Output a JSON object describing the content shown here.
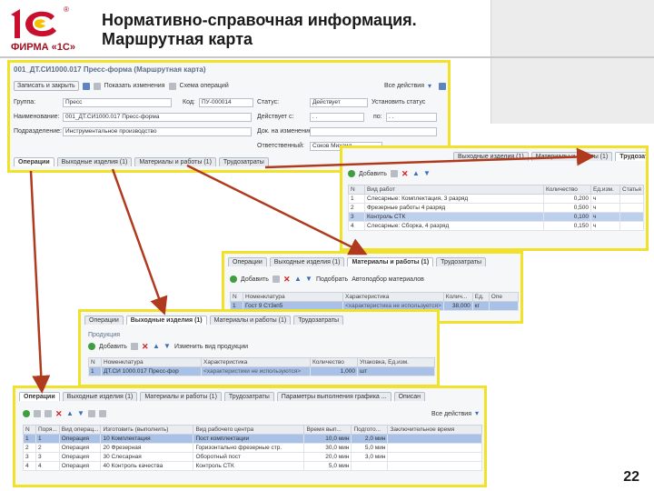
{
  "slide": {
    "title_line1": "Нормативно-справочная информация.",
    "title_line2": "Маршрутная карта",
    "page_number": "22",
    "logo_text": "ФИРМА «1С»",
    "logo_reg": "®"
  },
  "colors": {
    "highlight": "#f2e12a",
    "arrow": "#b03a1e",
    "selection": "#a9c1e6",
    "brand": "#a01020"
  },
  "main_form": {
    "title": "001_ДТ.СИ1000.017 Пресс-форма (Маршрутная карта)",
    "toolbar": {
      "save_close": "Записать и закрыть",
      "show_changes": "Показать изменения",
      "scheme": "Схема операций",
      "all_actions": "Все действия"
    },
    "fields": {
      "group_label": "Группа:",
      "group_value": "Пресс",
      "code_label": "Код:",
      "code_value": "ПУ-000014",
      "status_label": "Статус:",
      "status_value": "Действует",
      "set_status": "Установить статус",
      "name_label": "Наименование:",
      "name_value": "001_ДТ.СИ1000.017 Пресс-форма",
      "valid_from_label": "Действует с:",
      "valid_from_value": ".  .",
      "valid_to_label": "по:",
      "valid_to_value": ".  .",
      "division_label": "Подразделение:",
      "division_value": "Инструментальное производство",
      "document_label": "Док. на изменение:",
      "document_value": "",
      "responsible_label": "Ответственный:",
      "responsible_value": "Соков Михаил"
    },
    "tabs": [
      "Операции",
      "Выходные изделия (1)",
      "Материалы и работы (1)",
      "Трудозатраты"
    ]
  },
  "labor_panel": {
    "tabs": [
      "Выходные изделия (1)",
      "Материалы и работы (1)",
      "Трудозатраты (4)"
    ],
    "add_button": "Добавить",
    "columns": [
      "N",
      "Вид работ",
      "Количество",
      "Ед.изм.",
      "Статья"
    ],
    "rows": [
      {
        "n": "1",
        "work": "Слесарные: Комплектация, 3 разряд",
        "qty": "0,200",
        "unit": "ч",
        "selected": false
      },
      {
        "n": "2",
        "work": "Фрезерные работы  4 разряд",
        "qty": "0,500",
        "unit": "ч",
        "selected": false
      },
      {
        "n": "3",
        "work": "Контроль СТК",
        "qty": "0,100",
        "unit": "ч",
        "selected": true
      },
      {
        "n": "4",
        "work": "Слесарные: Сборка, 4 разряд",
        "qty": "0,150",
        "unit": "ч",
        "selected": false
      }
    ]
  },
  "materials_panel": {
    "tabs": [
      "Операции",
      "Выходные изделия (1)",
      "Материалы и работы (1)",
      "Трудозатраты"
    ],
    "add_button": "Добавить",
    "pick_button": "Подобрать",
    "autopick_button": "Автоподбор материалов",
    "columns": [
      "N",
      "Номенклатура",
      "Характеристика",
      "Колич...",
      "Ед.",
      "Опе"
    ],
    "rows": [
      {
        "n": "1",
        "item": "Гост 9 Ст3кп5",
        "char": "<характеристика не используется>",
        "qty": "38,000",
        "unit": "кг"
      }
    ]
  },
  "outputs_panel": {
    "tabs": [
      "Операции",
      "Выходные изделия (1)",
      "Материалы и работы (1)",
      "Трудозатраты"
    ],
    "section_label": "Продукция",
    "add_button": "Добавить",
    "change_button": "Изменить вид продукции",
    "columns": [
      "N",
      "Номенклатура",
      "Характеристика",
      "Количество",
      "Упаковка, Ед.изм."
    ],
    "rows": [
      {
        "n": "1",
        "item": "ДТ.СИ 1000.017 Пресс-фор",
        "char": "<характеристики не используются>",
        "qty": "1,000",
        "unit": "шт"
      }
    ]
  },
  "operations_panel": {
    "tabs": [
      "Операции",
      "Выходные изделия (1)",
      "Материалы и работы (1)",
      "Трудозатраты",
      "Параметры выполнения графика ...",
      "Описан"
    ],
    "all_actions": "Все действия",
    "columns": [
      "N",
      "Поря...",
      "Вид операц...",
      "Изготовить (выполнить)",
      "Вид рабочего центра",
      "Время вып...",
      "Подгото...",
      "Заключительное время"
    ],
    "rows": [
      {
        "n": "1",
        "order": "1",
        "type": "Операция",
        "make": "10 Комплектация",
        "wc": "Пост комплектации",
        "time": "10,0",
        "tu": "мин",
        "prep": "2,0",
        "pu": "мин",
        "selected": true
      },
      {
        "n": "2",
        "order": "2",
        "type": "Операция",
        "make": "20 Фрезерная",
        "wc": "Горизонтально фрезерные стр.",
        "time": "30,0",
        "tu": "мин",
        "prep": "5,0",
        "pu": "мин",
        "selected": false
      },
      {
        "n": "3",
        "order": "3",
        "type": "Операция",
        "make": "30 Слесарная",
        "wc": "Оборотный пост",
        "time": "20,0",
        "tu": "мин",
        "prep": "3,0",
        "pu": "мин",
        "selected": false
      },
      {
        "n": "4",
        "order": "4",
        "type": "Операция",
        "make": "40 Контроль качества",
        "wc": "Контроль СТК",
        "time": "5,0",
        "tu": "мин",
        "prep": "",
        "pu": "",
        "selected": false
      }
    ]
  }
}
